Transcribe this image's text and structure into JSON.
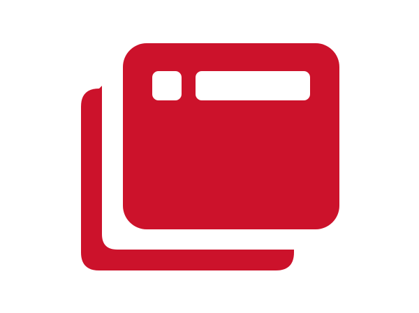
{
  "icon": {
    "name": "browser-windows-icon",
    "color": "#cc122b",
    "background": "#ffffff"
  }
}
